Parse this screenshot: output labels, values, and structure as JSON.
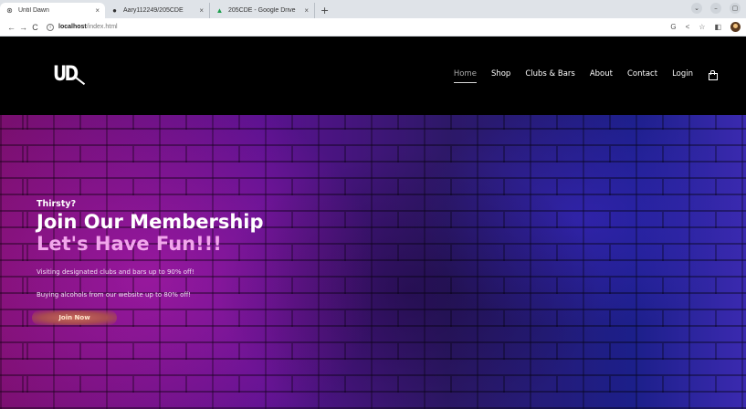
{
  "browser": {
    "tabs": [
      {
        "title": "Until Dawn",
        "icon": "globe-icon",
        "active": true
      },
      {
        "title": "Aary112249/205CDE",
        "icon": "github-icon",
        "active": false
      },
      {
        "title": "205CDE - Google Drive",
        "icon": "drive-icon",
        "active": false
      }
    ],
    "new_tab": "+",
    "address": {
      "host": "localhost",
      "path": "/index.html"
    }
  },
  "site": {
    "logo": "UD",
    "nav": [
      {
        "label": "Home",
        "current": true
      },
      {
        "label": "Shop"
      },
      {
        "label": "Clubs & Bars"
      },
      {
        "label": "About"
      },
      {
        "label": "Contact"
      },
      {
        "label": "Login"
      }
    ]
  },
  "hero": {
    "kicker": "Thirsty?",
    "headline": "Join Our Membership",
    "headline2": "Let's Have Fun!!!",
    "line1": "Visiting designated clubs and bars up to 90% off!",
    "line2": "Buying alcohols from our website up to 80% off!",
    "cta": "Join Now"
  },
  "colors": {
    "header_bg": "#000000",
    "accent_pink": "#f2a6ec",
    "cta": "#b85858"
  }
}
